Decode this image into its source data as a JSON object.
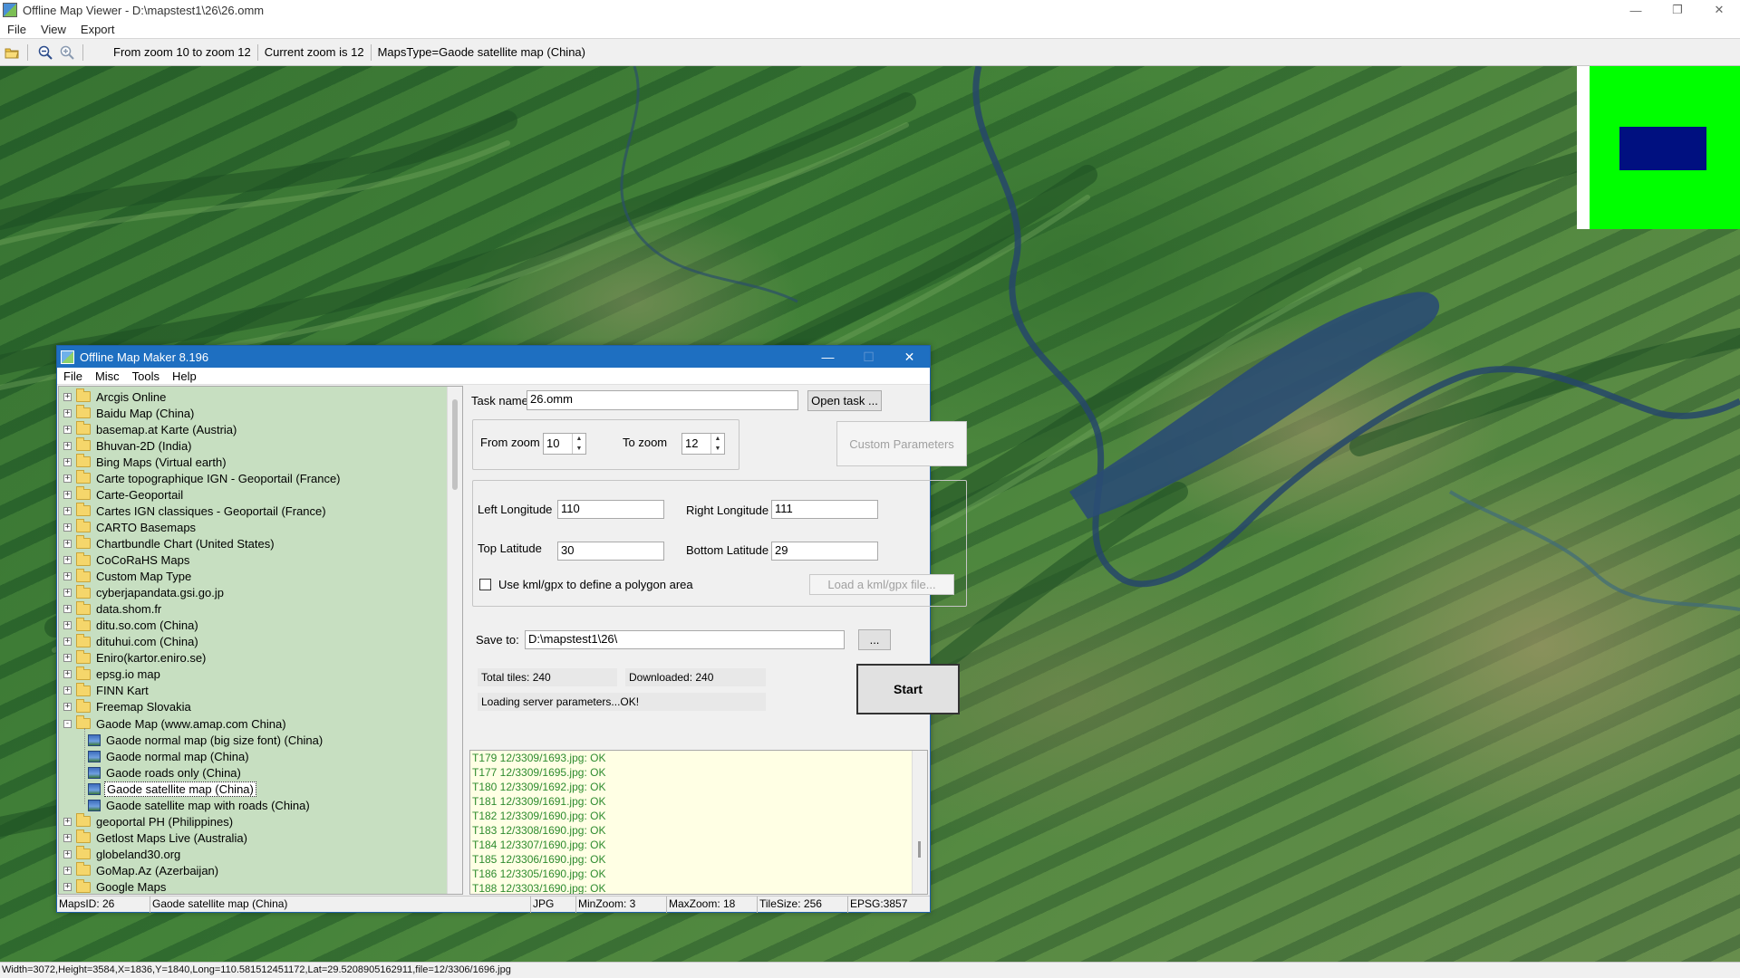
{
  "window": {
    "title": "Offline Map Viewer - D:\\mapstest1\\26\\26.omm",
    "min_glyph": "—",
    "restore_glyph": "❐",
    "close_glyph": "✕"
  },
  "menu": [
    "File",
    "View",
    "Export"
  ],
  "toolbar": {
    "from_to_zoom": "From zoom 10 to zoom 12",
    "current_zoom": "Current zoom is 12",
    "maps_type": "MapsType=Gaode satellite map (China)"
  },
  "status_bar": "Width=3072,Height=3584,X=1836,Y=1840,Long=110.581512451172,Lat=29.5208905162911,file=12/3306/1696.jpg",
  "dialog": {
    "title": "Offline Map Maker 8.196",
    "min_glyph": "—",
    "max_glyph": "☐",
    "close_glyph": "✕",
    "menu": [
      "File",
      "Misc",
      "Tools",
      "Help"
    ],
    "tree_items": [
      {
        "label": "Arcgis Online",
        "type": "folder",
        "expander": "+"
      },
      {
        "label": "Baidu Map (China)",
        "type": "folder",
        "expander": "+"
      },
      {
        "label": "basemap.at Karte (Austria)",
        "type": "folder",
        "expander": "+"
      },
      {
        "label": "Bhuvan-2D (India)",
        "type": "folder",
        "expander": "+"
      },
      {
        "label": "Bing Maps (Virtual earth)",
        "type": "folder",
        "expander": "+"
      },
      {
        "label": "Carte topographique IGN - Geoportail (France)",
        "type": "folder",
        "expander": "+"
      },
      {
        "label": "Carte-Geoportail",
        "type": "folder",
        "expander": "+"
      },
      {
        "label": "Cartes IGN classiques - Geoportail (France)",
        "type": "folder",
        "expander": "+"
      },
      {
        "label": "CARTO Basemaps",
        "type": "folder",
        "expander": "+"
      },
      {
        "label": "Chartbundle Chart (United States)",
        "type": "folder",
        "expander": "+"
      },
      {
        "label": "CoCoRaHS Maps",
        "type": "folder",
        "expander": "+"
      },
      {
        "label": "Custom Map Type",
        "type": "folder",
        "expander": "+"
      },
      {
        "label": "cyberjapandata.gsi.go.jp",
        "type": "folder",
        "expander": "+"
      },
      {
        "label": "data.shom.fr",
        "type": "folder",
        "expander": "+"
      },
      {
        "label": "ditu.so.com (China)",
        "type": "folder",
        "expander": "+"
      },
      {
        "label": "dituhui.com (China)",
        "type": "folder",
        "expander": "+"
      },
      {
        "label": "Eniro(kartor.eniro.se)",
        "type": "folder",
        "expander": "+"
      },
      {
        "label": "epsg.io map",
        "type": "folder",
        "expander": "+"
      },
      {
        "label": "FINN Kart",
        "type": "folder",
        "expander": "+"
      },
      {
        "label": "Freemap Slovakia",
        "type": "folder",
        "expander": "+"
      },
      {
        "label": "Gaode Map (www.amap.com China)",
        "type": "folder",
        "expander": "-"
      },
      {
        "label": "Gaode normal map (big size font) (China)",
        "type": "map",
        "expander": ""
      },
      {
        "label": "Gaode normal map (China)",
        "type": "map",
        "expander": ""
      },
      {
        "label": "Gaode roads only (China)",
        "type": "map",
        "expander": ""
      },
      {
        "label": "Gaode satellite map (China)",
        "type": "map",
        "expander": "",
        "selected": true
      },
      {
        "label": "Gaode satellite map with roads (China)",
        "type": "map",
        "expander": ""
      },
      {
        "label": "geoportal PH (Philippines)",
        "type": "folder",
        "expander": "+"
      },
      {
        "label": "Getlost Maps Live (Australia)",
        "type": "folder",
        "expander": "+"
      },
      {
        "label": "globeland30.org",
        "type": "folder",
        "expander": "+"
      },
      {
        "label": "GoMap.Az (Azerbaijan)",
        "type": "folder",
        "expander": "+"
      },
      {
        "label": "Google Maps",
        "type": "folder",
        "expander": "+"
      }
    ],
    "task_name_label": "Task name",
    "task_name_value": "26.omm",
    "open_task_button": "Open task ...",
    "from_zoom_label": "From zoom",
    "from_zoom_value": "10",
    "to_zoom_label": "To zoom",
    "to_zoom_value": "12",
    "custom_params_button": "Custom Parameters",
    "left_longitude_label": "Left Longitude",
    "left_longitude_value": "110",
    "right_longitude_label": "Right Longitude",
    "right_longitude_value": "111",
    "top_latitude_label": "Top Latitude",
    "top_latitude_value": "30",
    "bottom_latitude_label": "Bottom Latitude",
    "bottom_latitude_value": "29",
    "kml_checkbox_label": "Use kml/gpx to define a polygon area",
    "load_kml_button": "Load a kml/gpx file...",
    "save_to_label": "Save to:",
    "save_to_value": "D:\\mapstest1\\26\\",
    "browse_button": "...",
    "total_tiles": "Total tiles: 240",
    "downloaded": "Downloaded: 240",
    "loading_status": "Loading server parameters...OK!",
    "start_button": "Start",
    "log_lines": [
      "T179 12/3309/1693.jpg: OK",
      "T177 12/3309/1695.jpg: OK",
      "T180 12/3309/1692.jpg: OK",
      "T181 12/3309/1691.jpg: OK",
      "T182 12/3309/1690.jpg: OK",
      "T183 12/3308/1690.jpg: OK",
      "T184 12/3307/1690.jpg: OK",
      "T185 12/3306/1690.jpg: OK",
      "T186 12/3305/1690.jpg: OK",
      "T188 12/3303/1690.jpg: OK"
    ],
    "status": {
      "maps_id": "MapsID: 26",
      "map_name": "Gaode satellite map (China)",
      "format": "JPG",
      "min_zoom": "MinZoom: 3",
      "max_zoom": "MaxZoom: 18",
      "tile_size": "TileSize: 256",
      "epsg": "EPSG:3857"
    }
  },
  "colors": {
    "dialog_title_bg": "#1e6fc1",
    "tree_bg": "#c7dfc1",
    "log_bg": "#ffffe4",
    "log_text": "#2e8b2e",
    "overview_green": "#00ff00",
    "overview_rect": "#001080"
  }
}
